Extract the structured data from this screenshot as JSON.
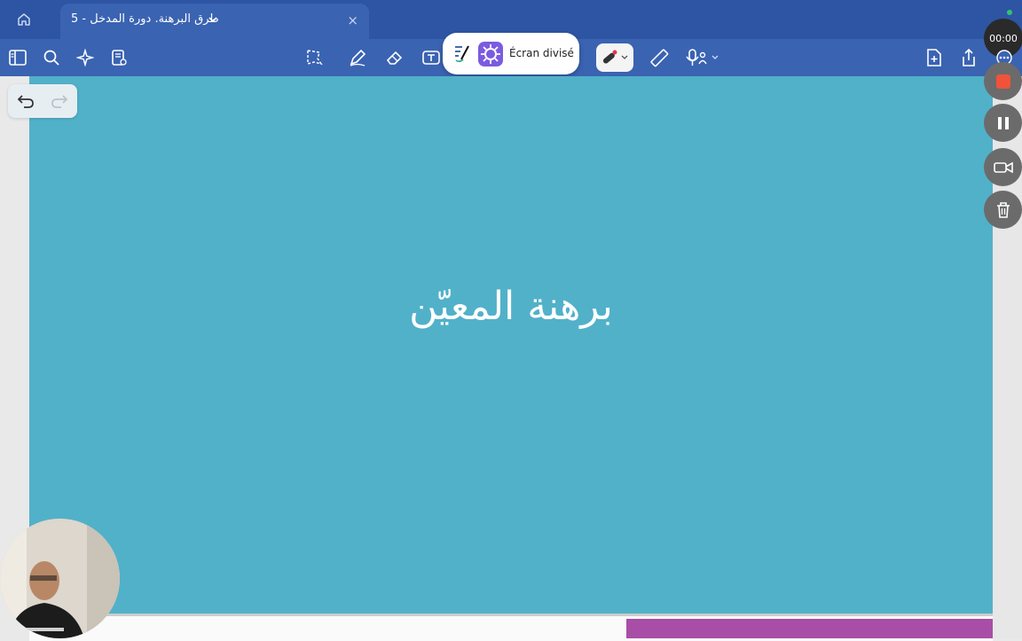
{
  "tab": {
    "title": "طرق البرهنة. دورة المدخل - 5",
    "close": "×"
  },
  "icons": {
    "home": "home-icon",
    "sidebar": "sidebar-icon",
    "search": "search-icon",
    "ai": "sparkle-icon",
    "page": "page-settings-icon",
    "lasso": "lasso-icon",
    "pen": "pen-icon",
    "eraser": "eraser-icon",
    "text": "text-tool-icon",
    "laser": "laser-pointer-icon",
    "ruler": "ruler-icon",
    "mic": "microphone-icon",
    "add_page": "add-page-icon",
    "share": "share-icon",
    "more": "more-icon"
  },
  "split_view": {
    "label": "Écran divisé"
  },
  "slide": {
    "text": "برهنة المعيّن"
  },
  "recorder": {
    "time": "00:00"
  },
  "colors": {
    "tab_bar": "#2d55a3",
    "toolbar": "#3a63b2",
    "slide_bg": "#51b1c9",
    "accent_purple": "#a84ea6",
    "stop": "#f0533a"
  }
}
